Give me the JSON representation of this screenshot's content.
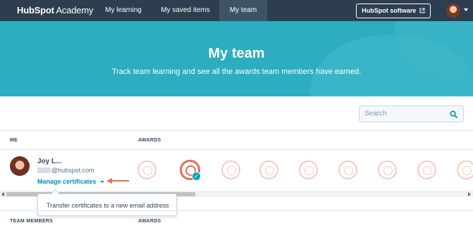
{
  "nav": {
    "logo_bold": "HubSpot",
    "logo_light": " Academy",
    "items": [
      {
        "label": "My learning"
      },
      {
        "label": "My saved items"
      },
      {
        "label": "My team"
      }
    ],
    "software_button": "HubSpot software"
  },
  "hero": {
    "title": "My team",
    "subtitle": "Track team learning and see all the awards team members have earned."
  },
  "search": {
    "placeholder": "Search"
  },
  "table": {
    "me_header": "ME",
    "awards_header": "AWARDS",
    "team_members_header": "TEAM MEMBERS",
    "awards_header_2": "AWARDS"
  },
  "me_row": {
    "name": "Joy L...",
    "email_domain": "@hubspot.com",
    "manage_link": "Manage certificates",
    "earned_badge_index": 2
  },
  "tooltip": {
    "text": "Transfer certificates to a new email address"
  },
  "colors": {
    "nav_bg": "#2d3e50",
    "hero_bg": "#2cadc0",
    "link": "#0091ae",
    "accent": "#e66e50",
    "check": "#00a4bd"
  }
}
